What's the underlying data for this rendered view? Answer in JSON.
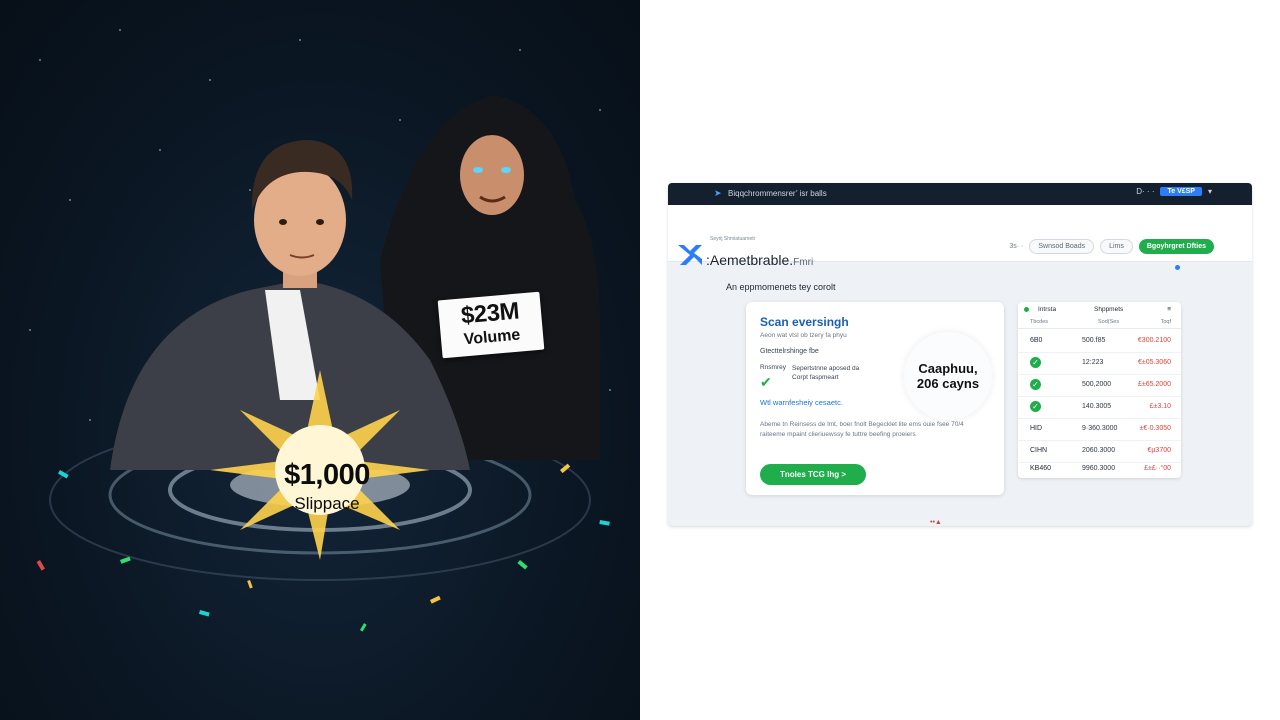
{
  "illustration": {
    "volume_sign": {
      "amount": "$23M",
      "label": "Volume"
    },
    "slippage_badge": {
      "amount": "$1,000",
      "label": "Slippace"
    }
  },
  "mockup": {
    "topbar": {
      "left_text": "Biqqchrommensrer’ isr balls",
      "right_text": "D· · ·",
      "button": "Te V£SP",
      "end": "▾"
    },
    "navbar": {
      "logo_tag": "Seyrij Shmiatuarnetr",
      "logo_text": ":Aemetbrable.",
      "logo_sub": "Fmri",
      "link": "3s· ·",
      "ghost1": "Swnsod Boads",
      "ghost2": "Lims",
      "green": "Bgoyhrgret Dfties"
    },
    "hero_title": "An eppmomenets tey corolt",
    "card": {
      "heading": "Scan eversingh",
      "sub": "Aeon wat vtsl ob tzery fa phyu",
      "line": "Gtecttelrshinge fbe",
      "check_label": "Rnsmrey",
      "check_text": "Sepertstnne aposed da Corpt faspmeart",
      "link": "Wtl warnfesheiy cesaetc.",
      "para": "Abeme tn Reinsess de lmt, boer fnolt Begecklet lite ems ouie fsee 70/4 raiteeme mpaint clieriuewssy fe tuttre beefing proeiers",
      "cta": "Tnoles TCG Ihg >",
      "badge_line1": "Caaphuu,",
      "badge_line2": "206 cayns"
    },
    "table": {
      "head": [
        "Intrsta",
        "Shppmets",
        "≡"
      ],
      "subhead": [
        "Tbcdes",
        "Sod(Ses",
        "Toqf"
      ],
      "rows": [
        {
          "c1": "6B0",
          "c2": "500.f85",
          "c3": "€300.2100",
          "icon": ""
        },
        {
          "c1": "",
          "c2": "12:223",
          "c3": "€±05.3060",
          "icon": "✓"
        },
        {
          "c1": "",
          "c2": "500,2000",
          "c3": "£±65.2000",
          "icon": "✓"
        },
        {
          "c1": "",
          "c2": "140.3005",
          "c3": "£±3.10",
          "icon": "✓"
        },
        {
          "c1": "HID",
          "c2": "9·360.3000",
          "c3": "±€·0.3050",
          "icon": ""
        },
        {
          "c1": "CIHN",
          "c2": "2060.3000",
          "c3": "€µ3700",
          "icon": ""
        },
        {
          "c1": "KB460",
          "c2": "9960.3000",
          "c3": "£±£··°00",
          "icon": ""
        }
      ]
    },
    "bottom_marker": "••▲"
  },
  "colors": {
    "accent_green": "#1fae4b",
    "accent_blue": "#2d7df6",
    "negative_red": "#e0433b",
    "dark_bg": "#0b1724"
  }
}
